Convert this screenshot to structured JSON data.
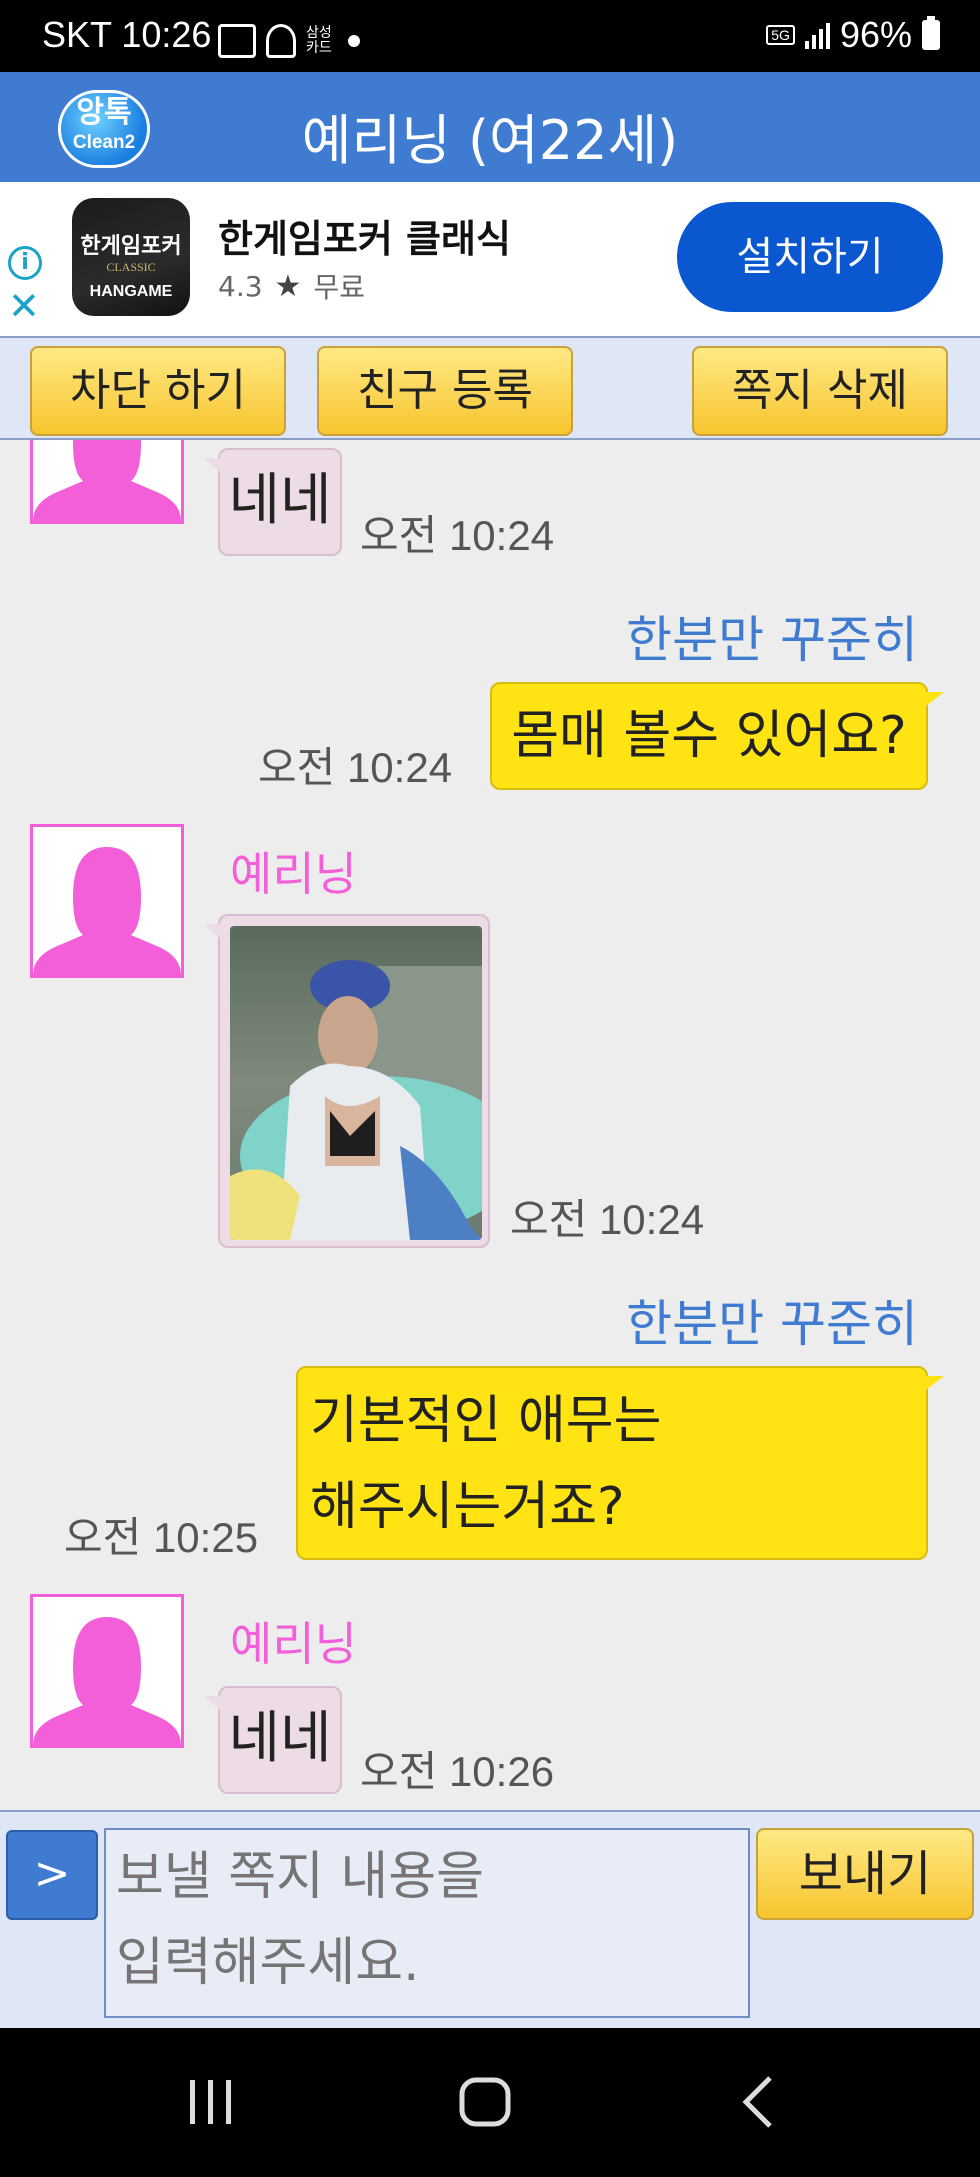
{
  "status_bar": {
    "carrier_time": "SKT 10:26",
    "samsung_card": "삼성\n카드",
    "network": "5G",
    "battery": "96%"
  },
  "header": {
    "logo_main": "앙톡",
    "logo_sub": "Clean2",
    "title": "예리닝 (여22세)"
  },
  "ad": {
    "icon_text_main": "한게임포커",
    "icon_text_classic": "CLASSIC",
    "icon_text_brand": "HANGAME",
    "app_name": "한게임포커 클래식",
    "rating": "4.3",
    "price": "무료",
    "install_label": "설치하기"
  },
  "actions": {
    "block_label": "차단 하기",
    "friend_label": "친구 등록",
    "delete_label": "쪽지 삭제"
  },
  "messages": [
    {
      "from": "them",
      "nick": "",
      "text": "네네",
      "time": "오전 10:24"
    },
    {
      "from": "me",
      "nick": "한분만 꾸준히",
      "text": "몸매 볼수 있어요?",
      "time": "오전 10:24"
    },
    {
      "from": "them",
      "nick": "예리닝",
      "text": "",
      "photo": true,
      "time": "오전 10:24"
    },
    {
      "from": "me",
      "nick": "한분만 꾸준히",
      "text_line1": "기본적인 애무는",
      "text_line2": "해주시는거죠?",
      "time": "오전 10:25"
    },
    {
      "from": "them",
      "nick": "예리닝",
      "text": "네네",
      "time": "오전 10:26"
    }
  ],
  "input": {
    "toggle_label": ">",
    "placeholder": "보낼 쪽지 내용을\n입력해주세요.",
    "send_label": "보내기"
  },
  "colors": {
    "header_blue": "#3f7bd1",
    "nick_pink": "#f25fd9",
    "my_bubble": "#ffe312",
    "their_bubble": "#eddbe6",
    "button_yellow": "#f7c52e"
  }
}
